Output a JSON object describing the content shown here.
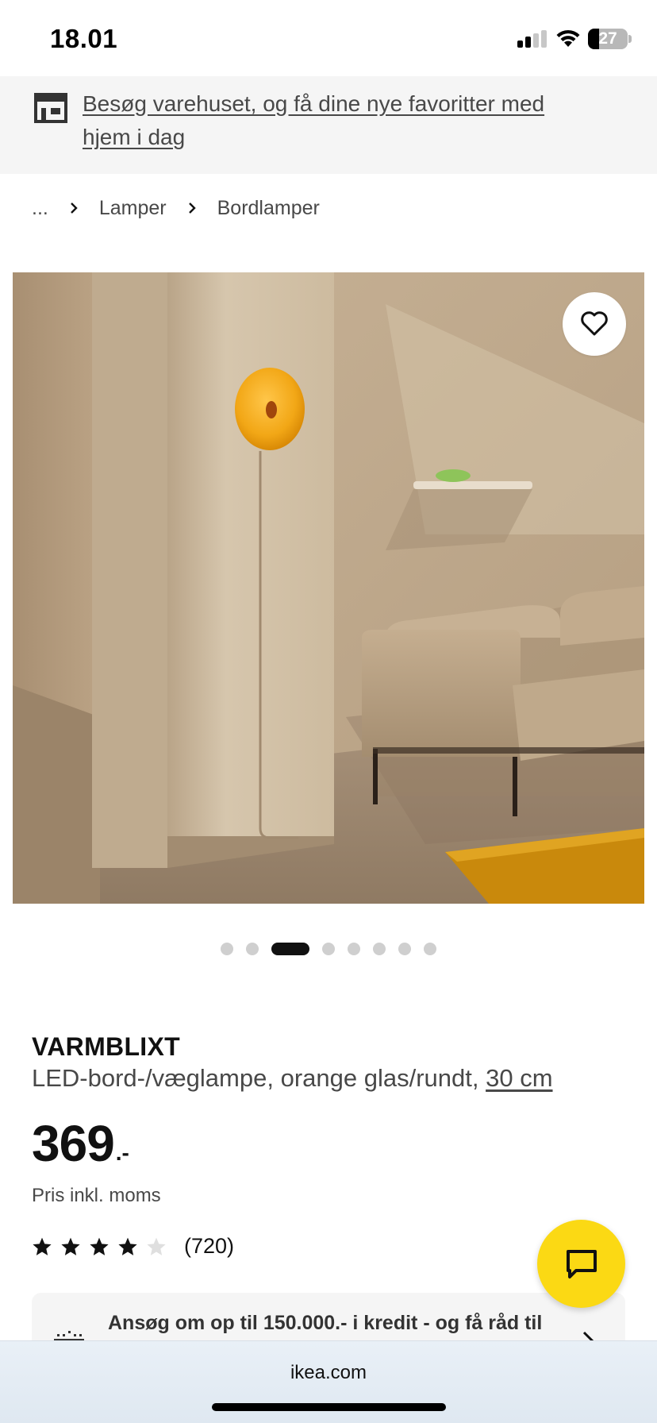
{
  "status_bar": {
    "time": "18.01",
    "battery": "27",
    "battery_level": 0.27
  },
  "promo": {
    "text": "Besøg varehuset, og få dine nye favoritter med hjem i dag",
    "icon": "store-icon"
  },
  "breadcrumb": {
    "items": [
      "...",
      "Lamper",
      "Bordlamper"
    ]
  },
  "gallery": {
    "total_images": 8,
    "active_index": 2,
    "favorite_icon": "heart-icon"
  },
  "product": {
    "name": "VARMBLIXT",
    "description": "LED-bord-/væglampe, orange glas/rundt,",
    "size": "30 cm",
    "price_int": "369",
    "price_dec": ".-",
    "price_note": "Pris inkl. moms",
    "rating": 4,
    "rating_max": 5,
    "review_count": "(720)"
  },
  "credit_banner": {
    "text": "Ansøg om op til 150.000.- i kredit - og få råd til"
  },
  "chat": {
    "icon": "chat-icon"
  },
  "browser": {
    "url": "ikea.com"
  },
  "colors": {
    "accent_yellow": "#FBD914",
    "text_primary": "#111111",
    "text_secondary": "#484848",
    "banner_bg": "#F5F5F5"
  }
}
